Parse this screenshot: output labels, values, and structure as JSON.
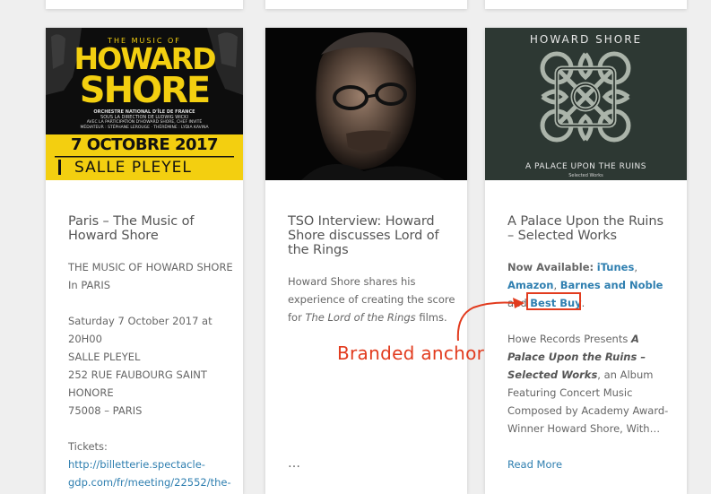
{
  "cards": [
    {
      "poster": {
        "kicker": "THE MUSIC OF",
        "name_line1": "HOWARD",
        "name_line2": "SHORE",
        "credits1": "ORCHESTRE NATIONAL D'ÎLE DE FRANCE",
        "credits2": "SOUS LA DIRECTION DE LUDWIG WICKI",
        "credits3": "AVEC LA PARTICIPATION D'HOWARD SHORE, CHEF INVITÉ",
        "credits4": "MÉDIATEUR : STÉPHANE LEROUGE · THÉRÉMINE : LYDIA KAVINA",
        "date": "7 OCTOBRE 2017",
        "venue": "SALLE PLEYEL"
      },
      "title": "Paris – The Music of Howard Shore",
      "lines": [
        "THE MUSIC OF HOWARD SHORE",
        "In PARIS",
        "Saturday 7 October 2017 at",
        "20H00",
        "SALLE PLEYEL",
        "252 RUE FAUBOURG SAINT",
        "HONORE",
        "75008 – PARIS",
        "Tickets:"
      ],
      "ticket_link_line1": "http://billetterie.spectacle-",
      "ticket_link_line2": "gdp.com/fr/meeting/22552/the-"
    },
    {
      "title": "TSO Interview: Howard Shore discusses Lord of the Rings",
      "text_line1": "Howard Shore shares his",
      "text_line2": "experience of creating the score",
      "text_line3_pre": "for",
      "text_line3_italic": "The Lord of the Rings",
      "text_line3_post": "films.",
      "ellipsis": "…"
    },
    {
      "album": {
        "artist": "HOWARD SHORE",
        "album_title": "A PALACE UPON THE RUINS",
        "album_subtitle": "Selected Works"
      },
      "title": "A Palace Upon the Ruins – Selected Works",
      "available_label": "Now Available:",
      "itunes": "iTunes",
      "comma1": ",",
      "amazon": "Amazon",
      "comma2": ",",
      "barnes": "Barnes and Noble",
      "and_word": "and",
      "bestbuy": "Best Buy",
      "period": ".",
      "desc_pre": "Howe Records Presents",
      "desc_italic1": "A",
      "desc_italic2": "Palace Upon the Ruins –",
      "desc_italic3": "Selected Works",
      "desc_line3_rest": ", an Album",
      "desc_line4": "Featuring Concert Music",
      "desc_line5": "Composed by Academy Award-",
      "desc_line6": "Winner Howard Shore, With…",
      "read_more": "Read More"
    }
  ],
  "annotation": {
    "label": "Branded anchor",
    "color": "#e23b1e"
  }
}
